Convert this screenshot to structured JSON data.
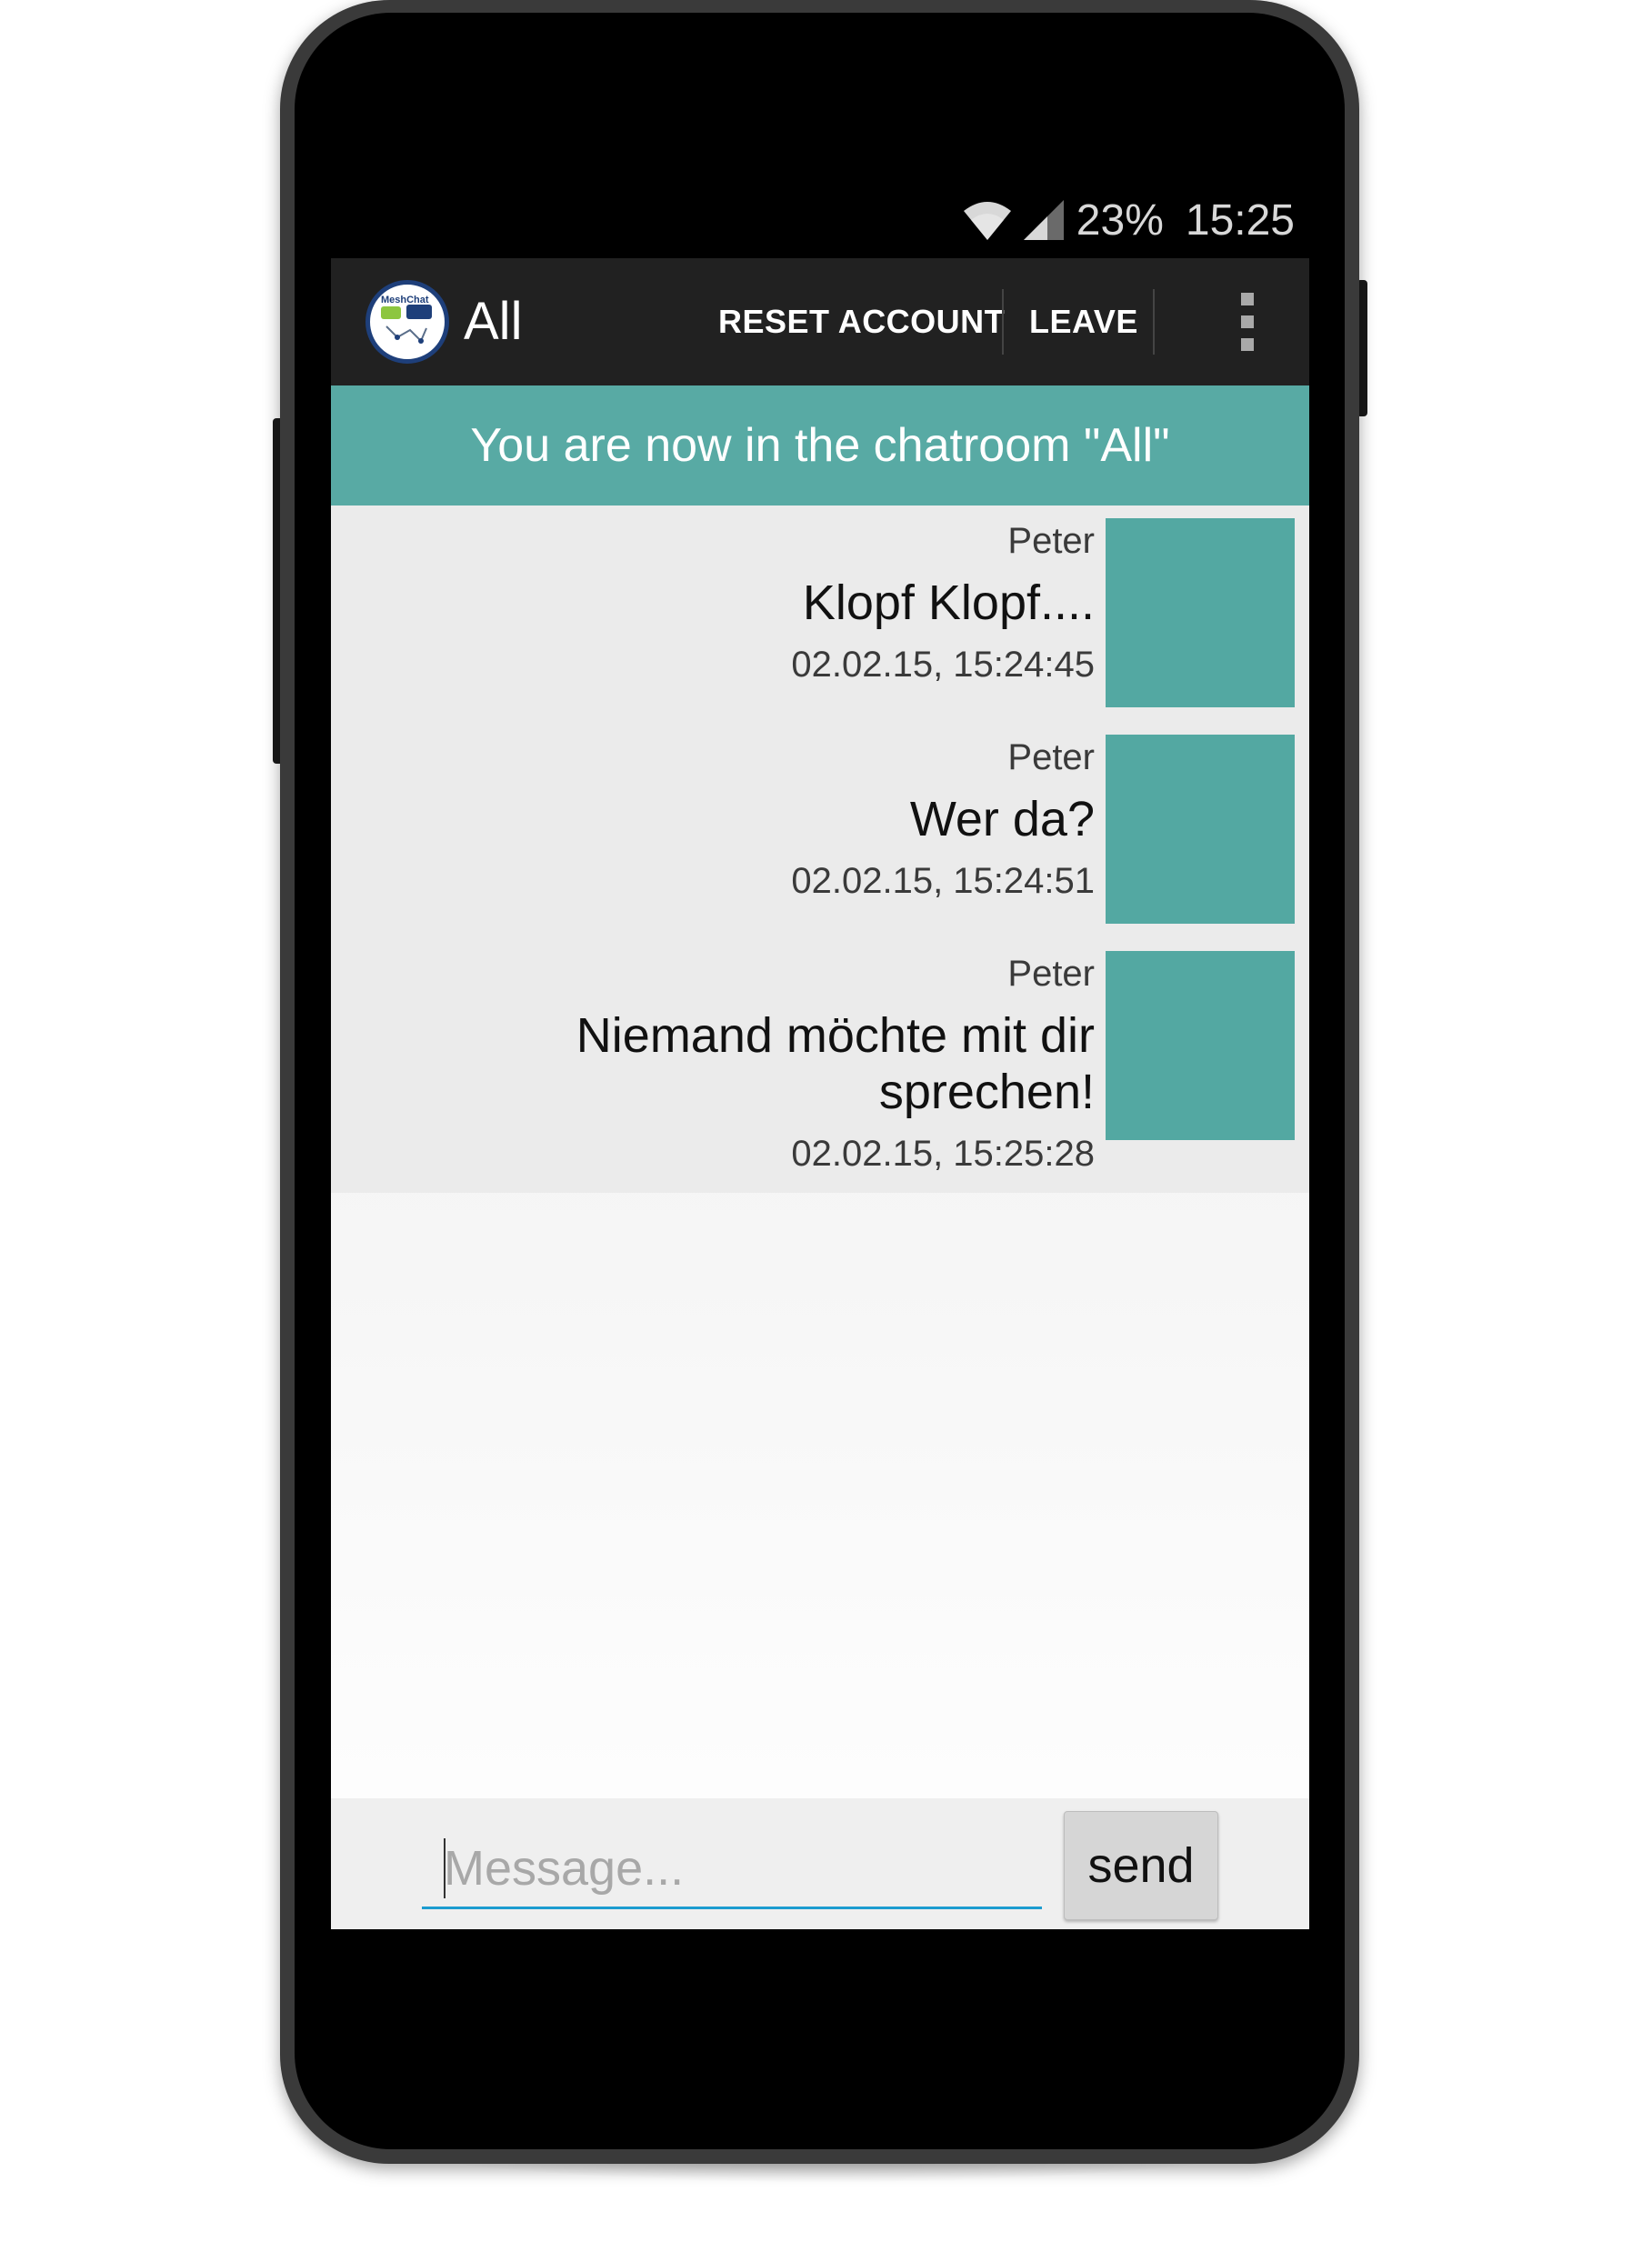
{
  "status_bar": {
    "battery": "23%",
    "time": "15:25",
    "icons": [
      "wifi-icon",
      "signal-icon"
    ]
  },
  "action_bar": {
    "title": "All",
    "logo_text": "MeshChat",
    "actions": [
      {
        "label": "RESET ACCOUNT"
      },
      {
        "label": "LEAVE"
      }
    ],
    "overflow_icon": "more-vert-icon"
  },
  "banner": {
    "text": "You are now in the chatroom \"All\""
  },
  "messages": [
    {
      "sender": "Peter",
      "text": "Klopf Klopf....",
      "time": "02.02.15, 15:24:45"
    },
    {
      "sender": "Peter",
      "text": "Wer da?",
      "time": "02.02.15, 15:24:51"
    },
    {
      "sender": "Peter",
      "text": "Niemand möchte mit dir sprechen!",
      "time": "02.02.15, 15:25:28"
    }
  ],
  "composer": {
    "placeholder": "Message...",
    "value": "",
    "send_label": "send"
  },
  "colors": {
    "accent": "#58aaa4",
    "avatar": "#53a8a2",
    "action_bar": "#212121",
    "input_underline": "#1c9cd0"
  }
}
